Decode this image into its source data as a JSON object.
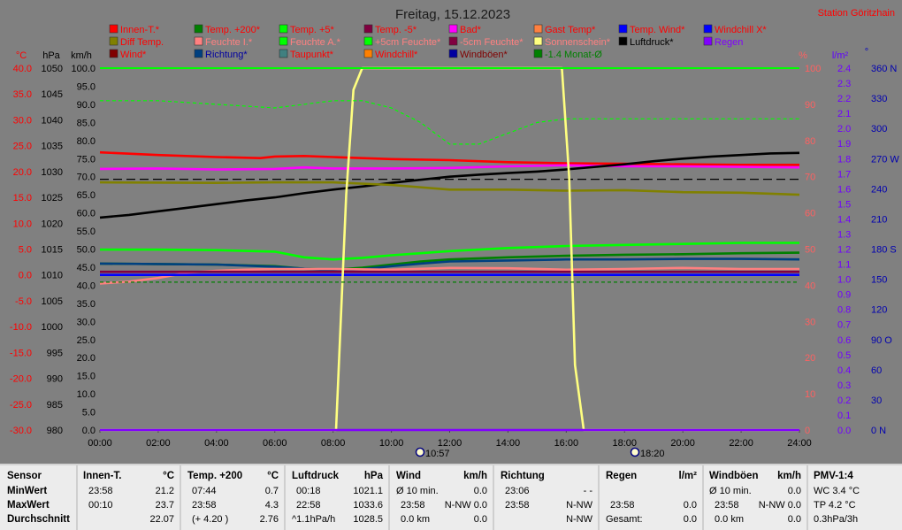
{
  "header": {
    "title": "Freitag, 15.12.2023",
    "station": "Station Göritzhain"
  },
  "legend": [
    {
      "label": "Innen-T.*",
      "color": "#ff0000",
      "text_color": "#ff0000"
    },
    {
      "label": "Temp. +200*",
      "color": "#008000",
      "text_color": "#ff0000"
    },
    {
      "label": "Temp. +5*",
      "color": "#00ff00",
      "text_color": "#ff0000"
    },
    {
      "label": "Temp. -5*",
      "color": "#800040",
      "text_color": "#ff0000"
    },
    {
      "label": "Bad*",
      "color": "#ff00ff",
      "text_color": "#ff0000"
    },
    {
      "label": "Gast Temp*",
      "color": "#ff8040",
      "text_color": "#ff0000"
    },
    {
      "label": "Temp. Wind*",
      "color": "#0000ff",
      "text_color": "#ff0000"
    },
    {
      "label": "Windchill X*",
      "color": "#0000ff",
      "text_color": "#ff0000"
    },
    {
      "label": "Diff Temp.",
      "color": "#808000",
      "text_color": "#ff0000"
    },
    {
      "label": "Feuchte I.*",
      "color": "#ff8080",
      "text_color": "#ff8080"
    },
    {
      "label": "Feuchte A.*",
      "color": "#00ff00",
      "text_color": "#ff8080"
    },
    {
      "label": "+5cm Feuchte*",
      "color": "#00ff00",
      "text_color": "#ff8080"
    },
    {
      "label": "-5cm Feuchte*",
      "color": "#800040",
      "text_color": "#ff8080"
    },
    {
      "label": "Sonnenschein*",
      "color": "#ffff80",
      "text_color": "#ff8080"
    },
    {
      "label": "Luftdruck*",
      "color": "#000000",
      "text_color": "#000000"
    },
    {
      "label": "Regen",
      "color": "#8000ff",
      "text_color": "#8000ff"
    },
    {
      "label": "Wind*",
      "color": "#800000",
      "text_color": "#ff0000"
    },
    {
      "label": "Richtung*",
      "color": "#004080",
      "text_color": "#0000a0"
    },
    {
      "label": "Taupunkt*",
      "color": "#408080",
      "text_color": "#ff0000"
    },
    {
      "label": "Windchill*",
      "color": "#ff8000",
      "text_color": "#ff0000"
    },
    {
      "label": "Windböen*",
      "color": "#0000a0",
      "text_color": "#800000"
    },
    {
      "label": "-1.4 Monat-Ø",
      "color": "#008000",
      "text_color": "#008000"
    }
  ],
  "axes": {
    "left_units": {
      "temp": "°C",
      "pressure": "hPa",
      "wind": "km/h"
    },
    "right_units": {
      "humidity": "%",
      "radiation": "l/m²",
      "direction": "°"
    },
    "temp_ticks": [
      "40.0",
      "35.0",
      "30.0",
      "25.0",
      "20.0",
      "15.0",
      "10.0",
      "5.0",
      "0.0",
      "-5.0",
      "-10.0",
      "-15.0",
      "-20.0",
      "-25.0",
      "-30.0"
    ],
    "pressure_ticks": [
      "1050",
      "1045",
      "1040",
      "1035",
      "1030",
      "1025",
      "1020",
      "1015",
      "1010",
      "1005",
      "1000",
      "995",
      "990",
      "985",
      "980"
    ],
    "wind_ticks": [
      "100.0",
      "95.0",
      "90.0",
      "85.0",
      "80.0",
      "75.0",
      "70.0",
      "65.0",
      "60.0",
      "55.0",
      "50.0",
      "45.0",
      "40.0",
      "35.0",
      "30.0",
      "25.0",
      "20.0",
      "15.0",
      "10.0",
      "5.0",
      "0.0"
    ],
    "humidity_ticks": [
      "100",
      "90",
      "80",
      "70",
      "60",
      "50",
      "40",
      "30",
      "20",
      "10",
      "0"
    ],
    "rain_ticks": [
      "2.4",
      "2.3",
      "2.2",
      "2.1",
      "2.0",
      "1.9",
      "1.8",
      "1.7",
      "1.6",
      "1.5",
      "1.4",
      "1.3",
      "1.2",
      "1.1",
      "1.0",
      "0.9",
      "0.8",
      "0.7",
      "0.6",
      "0.5",
      "0.4",
      "0.3",
      "0.2",
      "0.1",
      "0.0"
    ],
    "direction_ticks": [
      "360 N",
      "330",
      "300",
      "270 W",
      "240",
      "210",
      "180 S",
      "150",
      "120",
      "90 O",
      "60",
      "30",
      "0    N"
    ],
    "time_ticks": [
      "00:00",
      "02:00",
      "04:00",
      "06:00",
      "08:00",
      "10:00",
      "12:00",
      "14:00",
      "16:00",
      "18:00",
      "20:00",
      "22:00",
      "24:00"
    ]
  },
  "markers": {
    "sunrise": "10:57",
    "sunset": "18:20"
  },
  "chart_data": {
    "type": "line",
    "title": "Freitag, 15.12.2023",
    "x_unit": "time (hours)",
    "xlim": [
      0,
      24
    ],
    "y_axes": {
      "temperature_C": [
        -30,
        40
      ],
      "pressure_hPa": [
        980,
        1050
      ],
      "wind_kmh": [
        0,
        100
      ],
      "humidity_pct": [
        0,
        100
      ],
      "rain_lm2": [
        0,
        2.4
      ],
      "direction_deg": [
        0,
        360
      ]
    },
    "grid": false,
    "series": [
      {
        "name": "Innen-T.*",
        "axis": "temperature_C",
        "color": "#ff0000",
        "dash": false,
        "x": [
          0,
          2,
          4,
          5.5,
          6,
          7,
          8,
          10,
          12,
          14,
          16,
          18,
          20,
          22,
          24
        ],
        "y": [
          23.7,
          23.2,
          22.8,
          22.6,
          22.9,
          23.0,
          22.8,
          22.4,
          22.2,
          21.8,
          21.6,
          21.5,
          21.4,
          21.3,
          21.3
        ]
      },
      {
        "name": "Bad*",
        "axis": "temperature_C",
        "color": "#ff00ff",
        "dash": false,
        "x": [
          0,
          2,
          4,
          6,
          7,
          8,
          10,
          12,
          14,
          16,
          18,
          20,
          22,
          24
        ],
        "y": [
          20.5,
          20.6,
          20.4,
          20.5,
          20.8,
          20.6,
          20.6,
          20.7,
          21.0,
          21.2,
          21.0,
          21.0,
          20.9,
          20.8
        ]
      },
      {
        "name": "Luftdruck*",
        "axis": "pressure_hPa",
        "color": "#000000",
        "dash": false,
        "x": [
          0,
          1,
          2,
          3,
          4,
          5,
          6,
          7,
          8,
          9,
          10,
          11,
          12,
          13,
          14,
          15,
          16,
          17,
          18,
          19,
          20,
          21,
          22,
          23,
          24
        ],
        "y": [
          1021.1,
          1021.6,
          1022.3,
          1023.0,
          1023.7,
          1024.4,
          1025.0,
          1025.8,
          1026.5,
          1027.1,
          1027.8,
          1028.4,
          1029.0,
          1029.4,
          1029.7,
          1030.0,
          1030.4,
          1030.9,
          1031.4,
          1032.0,
          1032.5,
          1032.9,
          1033.2,
          1033.5,
          1033.6
        ]
      },
      {
        "name": "Diff Temp.",
        "axis": "temperature_C",
        "color": "#808000",
        "dash": false,
        "x": [
          0,
          4,
          6,
          8,
          10,
          12,
          14,
          16,
          18,
          20,
          22,
          24
        ],
        "y": [
          17.9,
          17.8,
          17.9,
          17.9,
          17.4,
          16.5,
          16.5,
          16.3,
          16.4,
          16.0,
          15.9,
          15.5
        ]
      },
      {
        "name": "Temp. +5*",
        "axis": "temperature_C",
        "color": "#00ff00",
        "dash": false,
        "x": [
          0,
          2,
          4,
          6,
          7,
          8,
          9,
          10,
          11,
          12,
          14,
          16,
          18,
          20,
          22,
          24
        ],
        "y": [
          4.9,
          4.9,
          4.8,
          4.5,
          3.4,
          3.0,
          3.3,
          3.8,
          4.2,
          4.6,
          5.2,
          5.6,
          5.8,
          6.0,
          6.2,
          6.2
        ]
      },
      {
        "name": "Temp. +200*",
        "axis": "temperature_C",
        "color": "#008000",
        "dash": false,
        "x": [
          0,
          2,
          4,
          6,
          7,
          8,
          9,
          10,
          11,
          12,
          14,
          16,
          18,
          20,
          22,
          24
        ],
        "y": [
          2.2,
          2.1,
          2.0,
          1.7,
          1.2,
          1.0,
          1.4,
          2.0,
          2.6,
          3.0,
          3.4,
          3.7,
          3.9,
          4.0,
          4.2,
          4.3
        ]
      },
      {
        "name": "Richtung*",
        "axis": "temperature_C",
        "color": "#004080",
        "dash": false,
        "x": [
          0,
          2,
          4,
          6,
          7,
          8,
          9,
          10,
          11,
          12,
          14,
          16,
          18,
          20,
          22,
          24
        ],
        "y": [
          2.2,
          2.1,
          2.0,
          1.6,
          1.2,
          0.9,
          1.1,
          1.7,
          2.2,
          2.6,
          2.8,
          3.0,
          3.0,
          3.1,
          3.1,
          3.0
        ]
      },
      {
        "name": "Feuchte I.*",
        "axis": "humidity_pct",
        "color": "#ff8080",
        "dash": false,
        "x": [
          0,
          1,
          2,
          3,
          4,
          5,
          6,
          8,
          10,
          12,
          14,
          16,
          18,
          20,
          22,
          24
        ],
        "y": [
          40.5,
          41.0,
          42.0,
          43.5,
          44.0,
          44.3,
          44.5,
          44.5,
          44.3,
          44.8,
          44.7,
          44.3,
          44.5,
          44.8,
          44.5,
          44.5
        ]
      },
      {
        "name": "Temp. -5*",
        "axis": "temperature_C",
        "color": "#800040",
        "dash": false,
        "x": [
          0,
          24
        ],
        "y": [
          0.6,
          0.6
        ]
      },
      {
        "name": "Temp. Wind*",
        "axis": "temperature_C",
        "color": "#0000ff",
        "dash": false,
        "x": [
          0,
          24
        ],
        "y": [
          0.0,
          0.0
        ]
      },
      {
        "name": "Sonnenschein*",
        "axis": "wind_kmh",
        "color": "#ffff80",
        "dash": false,
        "x": [
          0,
          8.1,
          8.45,
          8.7,
          9.0,
          15.85,
          16.1,
          16.3,
          16.6,
          24
        ],
        "y": [
          0,
          0,
          65,
          94,
          100,
          100,
          70,
          18,
          0,
          0
        ]
      },
      {
        "name": "Feuchte A.*",
        "axis": "humidity_pct",
        "color": "#00ff00",
        "dash": true,
        "x": [
          0,
          2,
          4,
          6,
          8,
          9,
          10,
          11,
          12,
          13,
          14,
          15,
          16,
          18,
          20,
          22,
          24
        ],
        "y": [
          91,
          91,
          90,
          89,
          91,
          91,
          89,
          85,
          79,
          79,
          82,
          85,
          86,
          86,
          86,
          86,
          86
        ]
      },
      {
        "name": "-1.4 Monat-Ø",
        "axis": "temperature_C",
        "color": "#008000",
        "dash": true,
        "x": [
          0,
          24
        ],
        "y": [
          -1.4,
          -1.4
        ]
      },
      {
        "name": "Regen",
        "axis": "rain_lm2",
        "color": "#8000ff",
        "dash": false,
        "x": [
          0,
          24
        ],
        "y": [
          0,
          0
        ]
      },
      {
        "name": "Humidity ref",
        "axis": "humidity_pct",
        "color": "#00ff00",
        "dash": false,
        "x": [
          0,
          24
        ],
        "y": [
          100,
          100
        ]
      }
    ],
    "reference_lines": [
      {
        "axis": "pressure_hPa",
        "y": 1028.5,
        "color": "#000000",
        "dash": true
      }
    ]
  },
  "stats": {
    "sensor": {
      "title": "Sensor",
      "min": "MinWert",
      "max": "MaxWert",
      "avg": "Durchschnitt"
    },
    "innen": {
      "title": "Innen-T.",
      "unit": "°C",
      "min_time": "23:58",
      "min_val": "21.2",
      "max_time": "00:10",
      "max_val": "23.7",
      "avg_val": "22.07"
    },
    "temp200": {
      "title": "Temp. +200",
      "unit": "°C",
      "min_time": "07:44",
      "min_val": "0.7",
      "max_time": "23:58",
      "max_val": "4.3",
      "avg_extra": "(+ 4.20 )",
      "avg_val": "2.76"
    },
    "luftdruck": {
      "title": "Luftdruck",
      "unit": "hPa",
      "min_time": "00:18",
      "min_val": "1021.1",
      "max_time": "22:58",
      "max_val": "1033.6",
      "avg_extra": "^1.1hPa/h",
      "avg_val": "1028.5"
    },
    "wind": {
      "title": "Wind",
      "unit": "km/h",
      "r1_label": "Ø 10 min.",
      "r1_val": "0.0",
      "r2_time": "23:58",
      "r2_val": "N-NW 0.0",
      "r3_label": "0.0 km",
      "r3_val": "0.0"
    },
    "richtung": {
      "title": "Richtung",
      "r1_time": "23:06",
      "r1_val": "- -",
      "r2_time": "23:58",
      "r2_val": "N-NW",
      "r3_val": "N-NW"
    },
    "regen": {
      "title": "Regen",
      "unit": "l/m²",
      "r2_time": "23:58",
      "r2_val": "0.0",
      "r3_label": "Gesamt:",
      "r3_val": "0.0"
    },
    "windboen": {
      "title": "Windböen",
      "unit": "km/h",
      "r1_label": "Ø 10 min.",
      "r1_val": "0.0",
      "r2_time": "23:58",
      "r2_val": "N-NW 0.0",
      "r3_label": "0.0 km",
      "r3_val": "0.0"
    },
    "pmv": {
      "title": "PMV-1:4",
      "r1": "WC 3.4 °C",
      "r2": "TP 4.2 °C",
      "r3": "0.3hPa/3h"
    }
  }
}
